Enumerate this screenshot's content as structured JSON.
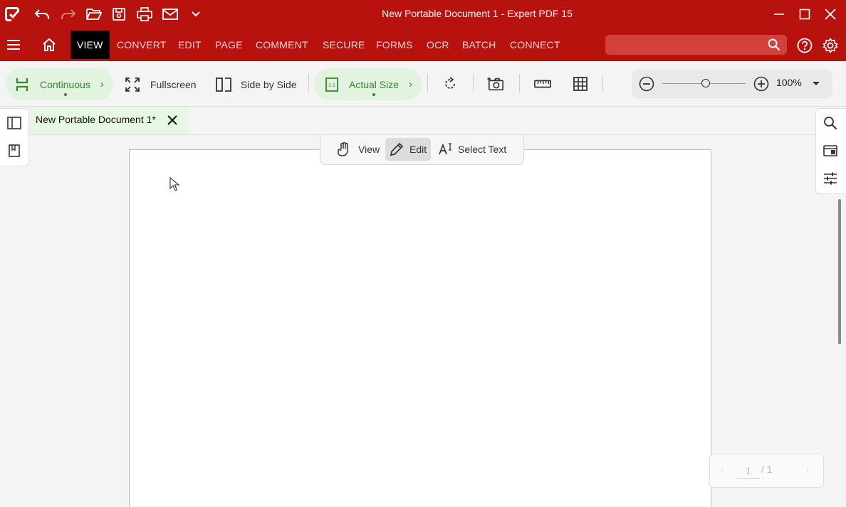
{
  "window": {
    "title": "New Portable Document 1   -   Expert PDF 15"
  },
  "quick_access": {
    "icons": [
      "app-logo-icon",
      "undo-icon",
      "redo-icon",
      "open-folder-icon",
      "save-icon",
      "print-icon",
      "email-icon",
      "chevron-down-icon"
    ]
  },
  "ribbon": {
    "tabs": [
      "VIEW",
      "CONVERT",
      "EDIT",
      "PAGE",
      "COMMENT",
      "SECURE",
      "FORMS",
      "OCR",
      "BATCH",
      "CONNECT"
    ],
    "active_tab": "VIEW",
    "search_placeholder": ""
  },
  "toolbar": {
    "continuous": "Continuous",
    "fullscreen": "Fullscreen",
    "side_by_side": "Side by Side",
    "actual_size": "Actual Size",
    "zoom_value": "100%",
    "zoom_level": 0.52
  },
  "document": {
    "tab_name": "New Portable Document 1*"
  },
  "modes": {
    "view": "View",
    "edit": "Edit",
    "select_text": "Select Text",
    "active": "Edit"
  },
  "pager": {
    "current": "1",
    "total": "/ 1"
  },
  "colors": {
    "brand_red": "#b8120e",
    "accent_green": "#2f8a2a",
    "green_fill": "#e2f4df"
  }
}
